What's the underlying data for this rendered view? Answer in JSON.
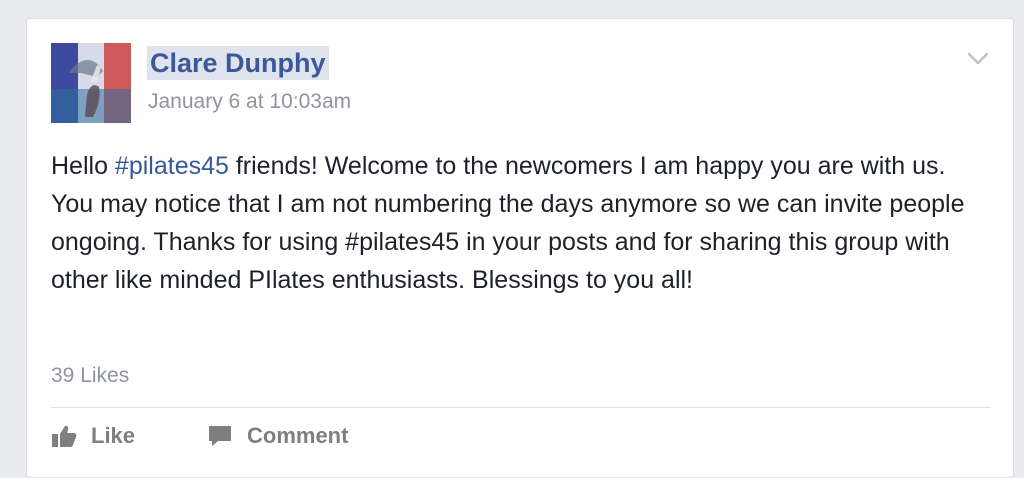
{
  "post": {
    "author": "Clare Dunphy",
    "timestamp": "January 6 at 10:03am",
    "body": {
      "t1": "Hello ",
      "h1": "#pilates45",
      "t2": " friends! Welcome to the newcomers I am happy you are with us. You may notice that I am not numbering the days anymore so we can invite people ongoing. Thanks for using #pilates45 in your posts and for sharing this group with other like minded PIlates enthusiasts. Blessings to you all!"
    },
    "likes": "39 Likes"
  },
  "actions": {
    "like_label": "Like",
    "comment_label": "Comment"
  },
  "icons": {
    "avatar": "profile-photo",
    "menu": "chevron-down-icon",
    "like": "thumbs-up-icon",
    "comment": "speech-bubble-icon"
  },
  "colors": {
    "link": "#365899",
    "name": "#3b5998",
    "muted": "#90949c",
    "text": "#1d2129"
  }
}
